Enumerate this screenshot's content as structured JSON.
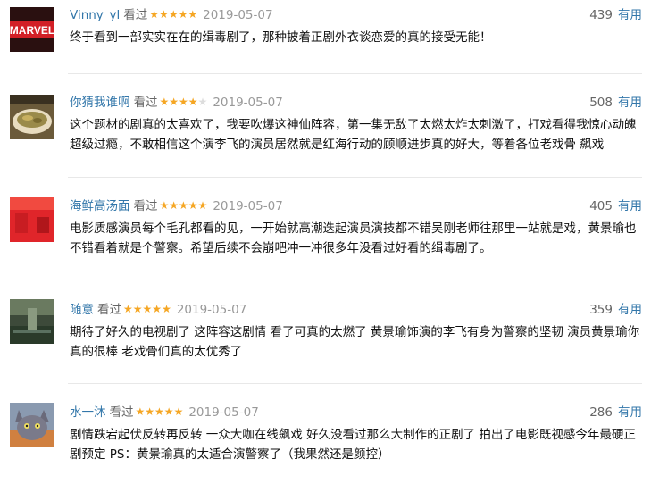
{
  "comments": [
    {
      "user": "Vinny_yl",
      "watched": "看过",
      "rating": 5,
      "date": "2019-05-07",
      "votes": "439",
      "useful": "有用",
      "text": "终于看到一部实实在在的缉毒剧了，那种披着正剧外衣谈恋爱的真的接受无能！",
      "avatar": "marvel-logo-avatar"
    },
    {
      "user": "你猜我谁啊",
      "watched": "看过",
      "rating": 4,
      "date": "2019-05-07",
      "votes": "508",
      "useful": "有用",
      "text": "这个题材的剧真的太喜欢了，我要吹爆这神仙阵容，第一集无敌了太燃太炸太刺激了，打戏看得我惊心动魄超级过瘾，不敢相信这个演李飞的演员居然就是红海行动的顾顺进步真的好大，等着各位老戏骨 飙戏",
      "avatar": "food-bowl-avatar"
    },
    {
      "user": "海鲜高汤面",
      "watched": "看过",
      "rating": 5,
      "date": "2019-05-07",
      "votes": "405",
      "useful": "有用",
      "text": "电影质感演员每个毛孔都看的见，一开始就高潮迭起演员演技都不错吴刚老师往那里一站就是戏，黄景瑜也不错看着就是个警察。希望后续不会崩吧冲一冲很多年没看过好看的缉毒剧了。",
      "avatar": "red-poster-avatar"
    },
    {
      "user": "随意",
      "watched": "看过",
      "rating": 5,
      "date": "2019-05-07",
      "votes": "359",
      "useful": "有用",
      "text": "期待了好久的电视剧了 这阵容这剧情 看了可真的太燃了 黄景瑜饰演的李飞有身为警察的坚韧 演员黄景瑜你真的很棒 老戏骨们真的太优秀了",
      "avatar": "landscape-avatar"
    },
    {
      "user": "水一沐",
      "watched": "看过",
      "rating": 5,
      "date": "2019-05-07",
      "votes": "286",
      "useful": "有用",
      "text": "剧情跌宕起伏反转再反转 一众大咖在线飙戏 好久没看过那么大制作的正剧了 拍出了电影既视感今年最硬正剧预定 PS：黄景瑜真的太适合演警察了（我果然还是颜控）",
      "avatar": "cat-photo-avatar"
    }
  ],
  "star_glyph": "★",
  "colors": {
    "link": "#3377aa",
    "star": "#f5a623",
    "meta_text": "#999999",
    "body_text": "#111111"
  }
}
